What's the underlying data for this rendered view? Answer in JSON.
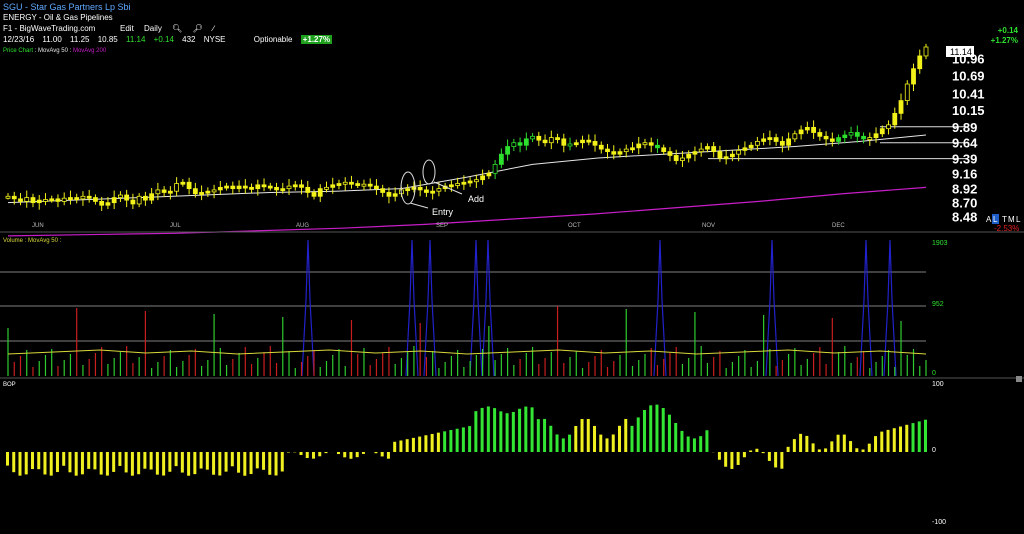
{
  "header": {
    "symbol_title": "SGU - Star Gas Partners Lp Sbi",
    "industry": "ENERGY - Oil & Gas Pipelines",
    "chart_source": "F1 - BigWaveTrading.com",
    "toolbar": {
      "edit": "Edit",
      "period": "Daily"
    },
    "quote": {
      "date": "12/23/16",
      "open": "11.00",
      "high": "11.25",
      "low": "10.85",
      "close": "11.14",
      "change": "+0.14",
      "volume": "432",
      "exchange": "NYSE",
      "optionable": "Optionable",
      "pct_badge": "+1.27%"
    },
    "ma_legend": {
      "label": "Price Chart",
      "ma50": "MovAvg 50",
      "ma200": "MovAvg 200"
    },
    "right_change": "+0.14",
    "right_pct": "+1.27%"
  },
  "price_pane": {
    "last_price_tag": "11.14",
    "annotations": {
      "entry": "Entry",
      "add": "Add"
    },
    "right_labels": {
      "a": "A",
      "l": "L",
      "t": "T",
      "m": "M",
      "l2": "L",
      "pct": "-2.53%"
    }
  },
  "volume_pane": {
    "title": "Volume : MovAvg 50 :",
    "ticks": [
      "1903",
      "952",
      "0"
    ]
  },
  "bop_pane": {
    "title": "BOP",
    "ticks": [
      "100",
      "0",
      "-100"
    ]
  },
  "colors": {
    "up_candle": "#f2f21a",
    "green_candle": "#2ee02e",
    "ma50": "#e6e6e6",
    "ma200": "#c81ec8",
    "vol_up": "#2ecc2e",
    "vol_down": "#c81e1e",
    "vol_ma": "#d8d83a",
    "ind_blue": "#2222cc",
    "bop_pos": "#33e633",
    "bop_neg": "#f0f020"
  },
  "chart_data": {
    "type": "candlestick",
    "x_ticks": [
      "JUN",
      "JUL",
      "AUG",
      "SEP",
      "OCT",
      "NOV",
      "DEC"
    ],
    "y_ticks": [
      10.96,
      10.69,
      10.41,
      10.15,
      9.89,
      9.64,
      9.39,
      9.16,
      8.92,
      8.7,
      8.48
    ],
    "ylim": [
      8.35,
      11.25
    ],
    "close_series": [
      8.8,
      8.76,
      8.72,
      8.78,
      8.7,
      8.74,
      8.75,
      8.76,
      8.72,
      8.77,
      8.78,
      8.76,
      8.8,
      8.78,
      8.72,
      8.66,
      8.7,
      8.78,
      8.82,
      8.74,
      8.68,
      8.8,
      8.74,
      8.84,
      8.9,
      8.86,
      8.88,
      9.0,
      9.02,
      8.92,
      8.84,
      8.86,
      8.88,
      8.9,
      8.94,
      8.96,
      8.92,
      8.96,
      8.94,
      8.92,
      8.98,
      8.96,
      8.94,
      8.9,
      8.92,
      8.96,
      8.98,
      8.94,
      8.86,
      8.8,
      8.92,
      8.94,
      8.98,
      9.0,
      9.02,
      9.0,
      8.98,
      8.99,
      8.96,
      8.92,
      8.86,
      8.8,
      8.84,
      8.9,
      8.92,
      8.94,
      8.9,
      8.86,
      8.88,
      8.92,
      8.96,
      8.98,
      9.0,
      9.02,
      9.04,
      9.06,
      9.12,
      9.16,
      9.3,
      9.46,
      9.58,
      9.64,
      9.6,
      9.7,
      9.74,
      9.68,
      9.64,
      9.72,
      9.7,
      9.6,
      9.62,
      9.64,
      9.68,
      9.66,
      9.6,
      9.54,
      9.5,
      9.46,
      9.5,
      9.54,
      9.56,
      9.62,
      9.64,
      9.6,
      9.56,
      9.5,
      9.44,
      9.36,
      9.4,
      9.46,
      9.5,
      9.54,
      9.58,
      9.5,
      9.4,
      9.42,
      9.46,
      9.52,
      9.56,
      9.6,
      9.66,
      9.7,
      9.72,
      9.66,
      9.6,
      9.7,
      9.78,
      9.84,
      9.88,
      9.8,
      9.74,
      9.7,
      9.66,
      9.72,
      9.76,
      9.8,
      9.74,
      9.7,
      9.72,
      9.78,
      9.86,
      9.92,
      10.1,
      10.3,
      10.56,
      10.8,
      11.0,
      11.14
    ],
    "ma50": [
      8.7,
      8.74,
      8.78,
      8.82,
      8.86,
      8.88,
      8.92,
      9.1,
      9.3,
      9.4,
      9.46,
      9.52,
      9.58,
      9.66,
      9.76
    ],
    "ma200": [
      8.18,
      8.2,
      8.22,
      8.26,
      8.3,
      8.36,
      8.44,
      8.52,
      8.62,
      8.72,
      8.84,
      8.94
    ],
    "support_lines": [
      9.89,
      9.64,
      9.39
    ]
  }
}
